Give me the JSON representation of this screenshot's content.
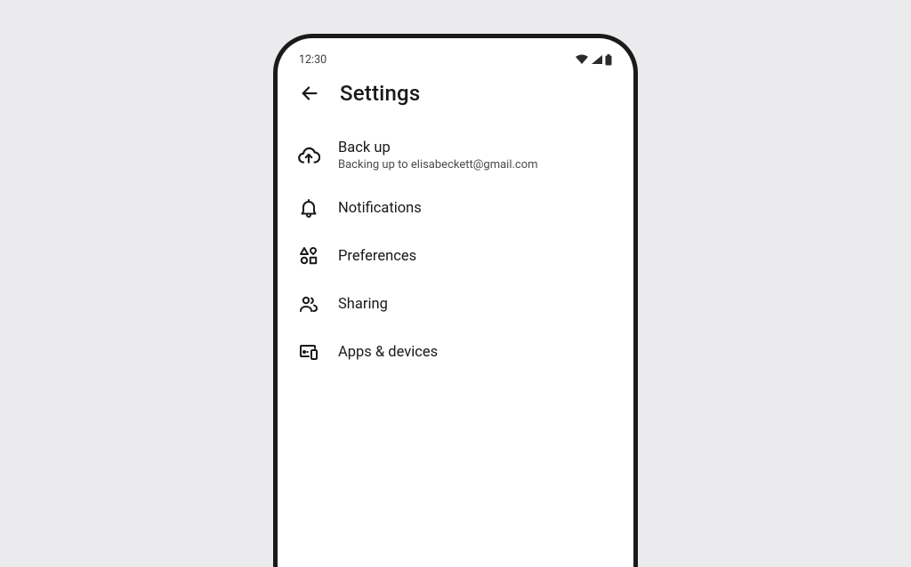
{
  "status": {
    "time": "12:30"
  },
  "header": {
    "title": "Settings"
  },
  "items": [
    {
      "label": "Back up",
      "sub": "Backing up to elisabeckett@gmail.com"
    },
    {
      "label": "Notifications"
    },
    {
      "label": "Preferences"
    },
    {
      "label": "Sharing"
    },
    {
      "label": "Apps & devices"
    }
  ]
}
